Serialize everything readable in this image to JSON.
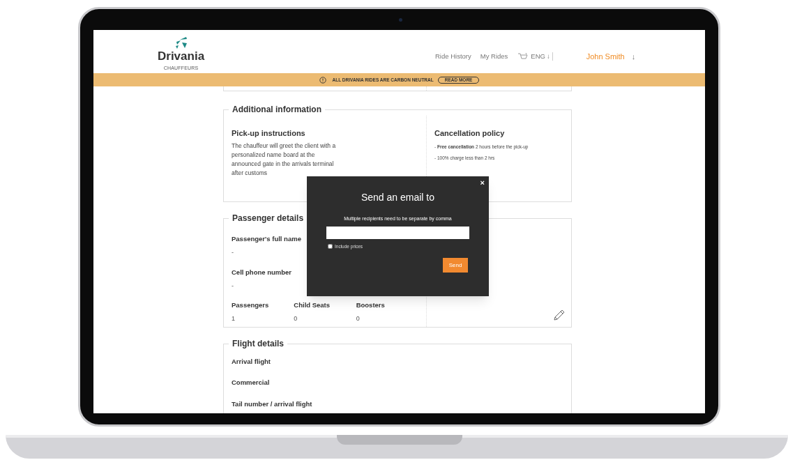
{
  "header": {
    "logo": {
      "name": "Drivania",
      "tagline": "CHAUFFEURS"
    },
    "nav": [
      {
        "label": "Ride History"
      },
      {
        "label": "My Rides"
      }
    ],
    "language": "ENG",
    "language_caret": "↓",
    "user": "John Smith",
    "user_caret": "↓"
  },
  "banner": {
    "text": "ALL DRIVANIA RIDES ARE CARBON NEUTRAL",
    "button": "READ MORE"
  },
  "additional_information": {
    "title": "Additional information",
    "left": {
      "heading": "Pick-up instructions",
      "text": "The chauffeur will greet the client with a personalized name board at the announced gate in the arrivals terminal after customs"
    },
    "right": {
      "heading": "Cancellation policy",
      "lines": [
        "- **Free cancellation** 2 hours before the pick-up",
        "- 100% charge less than 2 hrs"
      ]
    }
  },
  "passenger_details": {
    "title": "Passenger details",
    "fields": [
      {
        "label": "Passenger's full name",
        "value": "-"
      },
      {
        "label": "Cell phone number",
        "value": "-"
      }
    ],
    "counts": [
      {
        "label": "Passengers",
        "value": "1"
      },
      {
        "label": "Child Seats",
        "value": "0"
      },
      {
        "label": "Boosters",
        "value": "0"
      }
    ]
  },
  "flight_details": {
    "title": "Flight details",
    "fields": [
      "Arrival flight",
      "Commercial",
      "Tail number / arrival flight"
    ]
  },
  "modal": {
    "close": "×",
    "title": "Send an email to",
    "hint": "Multiple recipients need to be separate by comma",
    "include_prices": {
      "label": "Include prices",
      "checked": false
    },
    "send": "Send"
  }
}
